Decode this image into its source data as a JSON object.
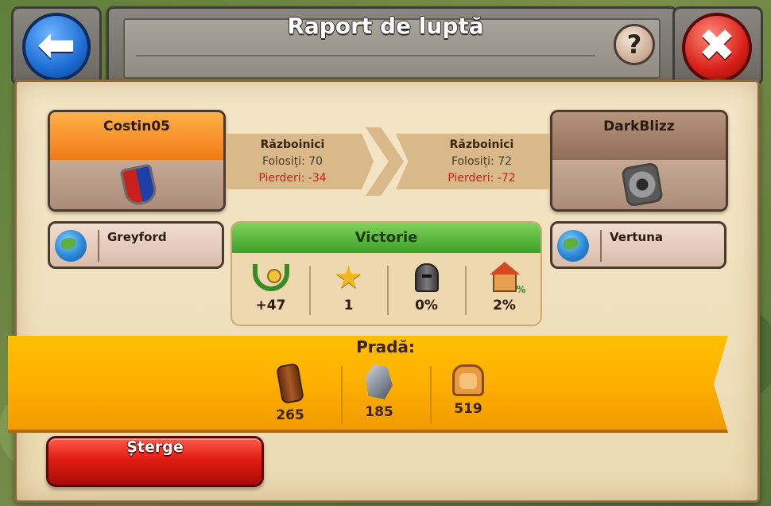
{
  "header": {
    "title": "Raport de luptă",
    "help_label": "?"
  },
  "attacker": {
    "name": "Costin05",
    "troops_label": "Războinici",
    "used_text": "Folosiți: 70",
    "losses_text": "Pierderi: -34",
    "castle": "Greyford"
  },
  "defender": {
    "name": "DarkBlizz",
    "troops_label": "Războinici",
    "used_text": "Folosiți: 72",
    "losses_text": "Pierderi: -72",
    "castle": "Vertuna"
  },
  "result": {
    "label": "Victorie",
    "stats": [
      {
        "icon": "laurel-icon",
        "value": "+47"
      },
      {
        "icon": "star-icon",
        "value": "1"
      },
      {
        "icon": "helmet-icon",
        "value": "0%"
      },
      {
        "icon": "house-icon",
        "value": "2%"
      }
    ]
  },
  "loot": {
    "title": "Pradă:",
    "items": [
      {
        "icon": "wood-icon",
        "value": "265"
      },
      {
        "icon": "stone-icon",
        "value": "185"
      },
      {
        "icon": "food-icon",
        "value": "519"
      }
    ]
  },
  "actions": {
    "delete_label": "Șterge"
  },
  "colors": {
    "victory_green": "#3d9f2a",
    "loot_orange": "#ffb200",
    "delete_red": "#e01c12",
    "attacker_orange": "#f07a12",
    "loss_red": "#c8201c"
  }
}
